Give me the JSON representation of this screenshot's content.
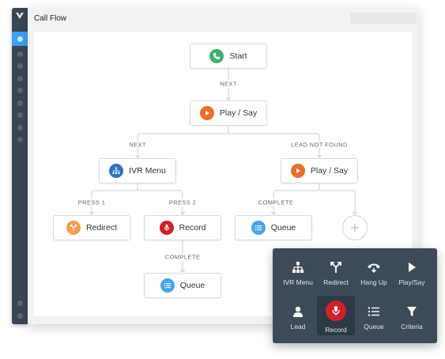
{
  "window": {
    "title": "Call Flow"
  },
  "colors": {
    "rail_bg": "#3a4655",
    "rail_active": "#3ea0f0",
    "start_green": "#3cb371",
    "play_orange": "#e8702a",
    "ivr_blue": "#2f74c0",
    "redirect_orange": "#f0a050",
    "record_red": "#d0202c",
    "queue_blue": "#4aa3e8",
    "palette_bg": "#3d4a59"
  },
  "flow": {
    "nodes": {
      "start": {
        "label": "Start",
        "icon": "phone-icon"
      },
      "play_say_main": {
        "label": "Play / Say",
        "icon": "play-icon"
      },
      "ivr_menu": {
        "label": "IVR Menu",
        "icon": "sitemap-icon"
      },
      "play_say_lead": {
        "label": "Play / Say",
        "icon": "play-icon"
      },
      "redirect": {
        "label": "Redirect",
        "icon": "redirect-icon"
      },
      "record": {
        "label": "Record",
        "icon": "microphone-icon"
      },
      "queue_lead": {
        "label": "Queue",
        "icon": "list-icon"
      },
      "queue_record": {
        "label": "Queue",
        "icon": "list-icon"
      }
    },
    "edge_labels": {
      "start_to_play": "NEXT",
      "play_to_ivr": "NEXT",
      "play_to_lead": "LEAD NOT FOUND",
      "ivr_press1": "PRESS 1",
      "ivr_press2": "PRESS 2",
      "lead_complete": "COMPLETE",
      "record_complete": "COMPLETE"
    }
  },
  "palette": {
    "items": [
      {
        "label": "IVR Menu",
        "icon": "sitemap-icon"
      },
      {
        "label": "Redirect",
        "icon": "redirect-icon"
      },
      {
        "label": "Hang Up",
        "icon": "hang-up-icon"
      },
      {
        "label": "Play/Say",
        "icon": "play-icon"
      },
      {
        "label": "Lead",
        "icon": "user-icon"
      },
      {
        "label": "Record",
        "icon": "microphone-icon",
        "selected": true
      },
      {
        "label": "Queue",
        "icon": "list-icon"
      },
      {
        "label": "Criteria",
        "icon": "filter-icon"
      }
    ]
  }
}
